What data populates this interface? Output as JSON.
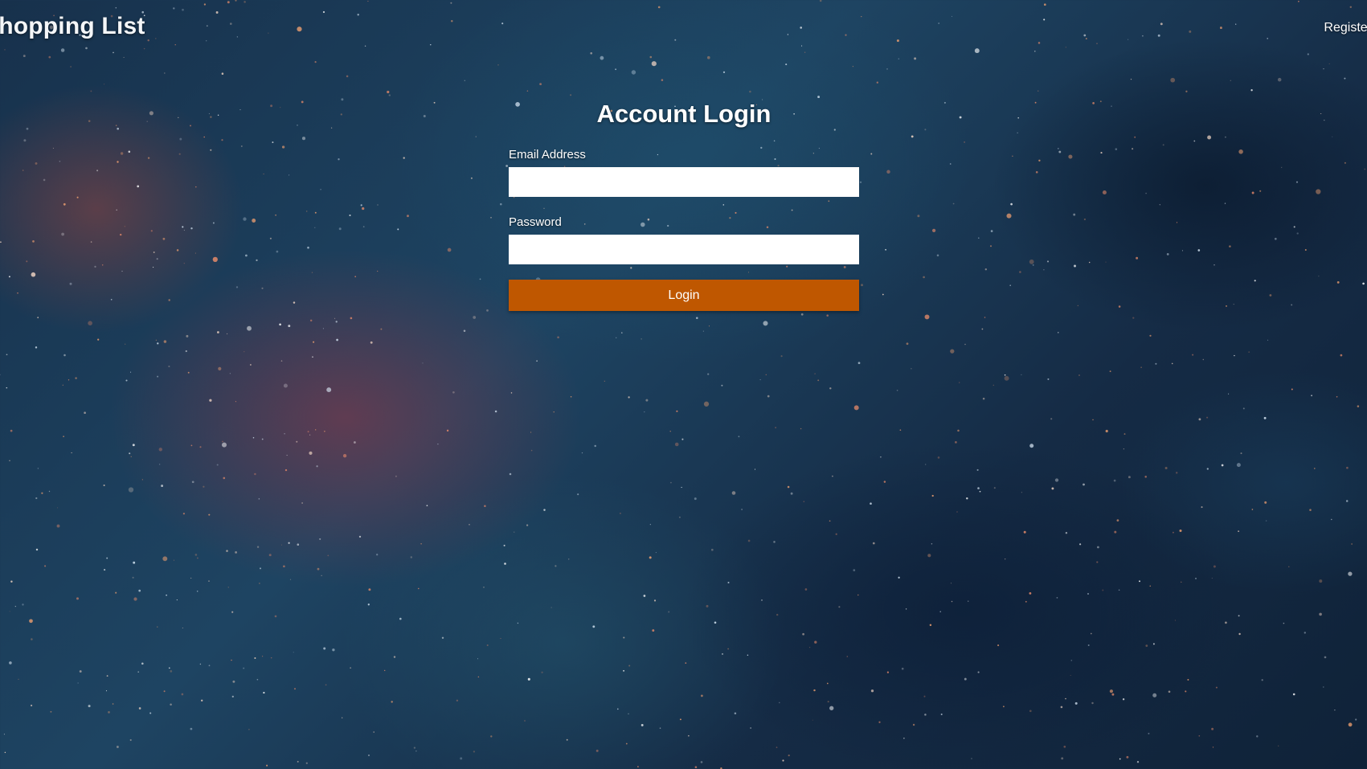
{
  "header": {
    "brand_title": "Shopping List",
    "register_link": "Register"
  },
  "login_form": {
    "title": "Account Login",
    "email_label": "Email Address",
    "email_value": "",
    "password_label": "Password",
    "password_value": "",
    "submit_label": "Login"
  },
  "colors": {
    "accent": "#bf5700",
    "background": "#1b3550",
    "text": "#ffffff"
  }
}
